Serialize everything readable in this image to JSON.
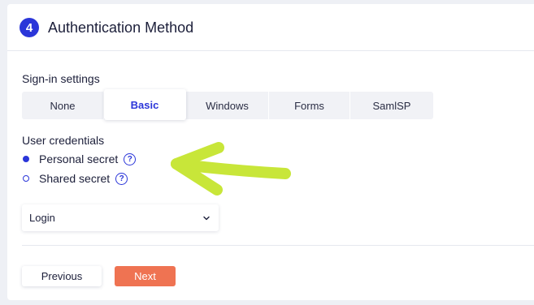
{
  "section": {
    "step_number": "4",
    "title": "Authentication Method"
  },
  "signin": {
    "label": "Sign-in settings",
    "tabs": [
      {
        "label": "None",
        "active": false
      },
      {
        "label": "Basic",
        "active": true
      },
      {
        "label": "Windows",
        "active": false
      },
      {
        "label": "Forms",
        "active": false
      },
      {
        "label": "SamlSP",
        "active": false
      }
    ]
  },
  "credentials": {
    "label": "User credentials",
    "options": [
      {
        "label": "Personal secret",
        "selected": true,
        "help": "?"
      },
      {
        "label": "Shared secret",
        "selected": false,
        "help": "?"
      }
    ]
  },
  "login_select": {
    "value": "Login"
  },
  "footer": {
    "previous_label": "Previous",
    "next_label": "Next"
  },
  "colors": {
    "accent": "#2b36d9",
    "next_button": "#ef7352",
    "annotation_arrow": "#c8e639"
  },
  "icons": {
    "help": "question-circle-icon",
    "dropdown": "chevron-down-icon",
    "annotation": "arrow-left-annotation"
  }
}
